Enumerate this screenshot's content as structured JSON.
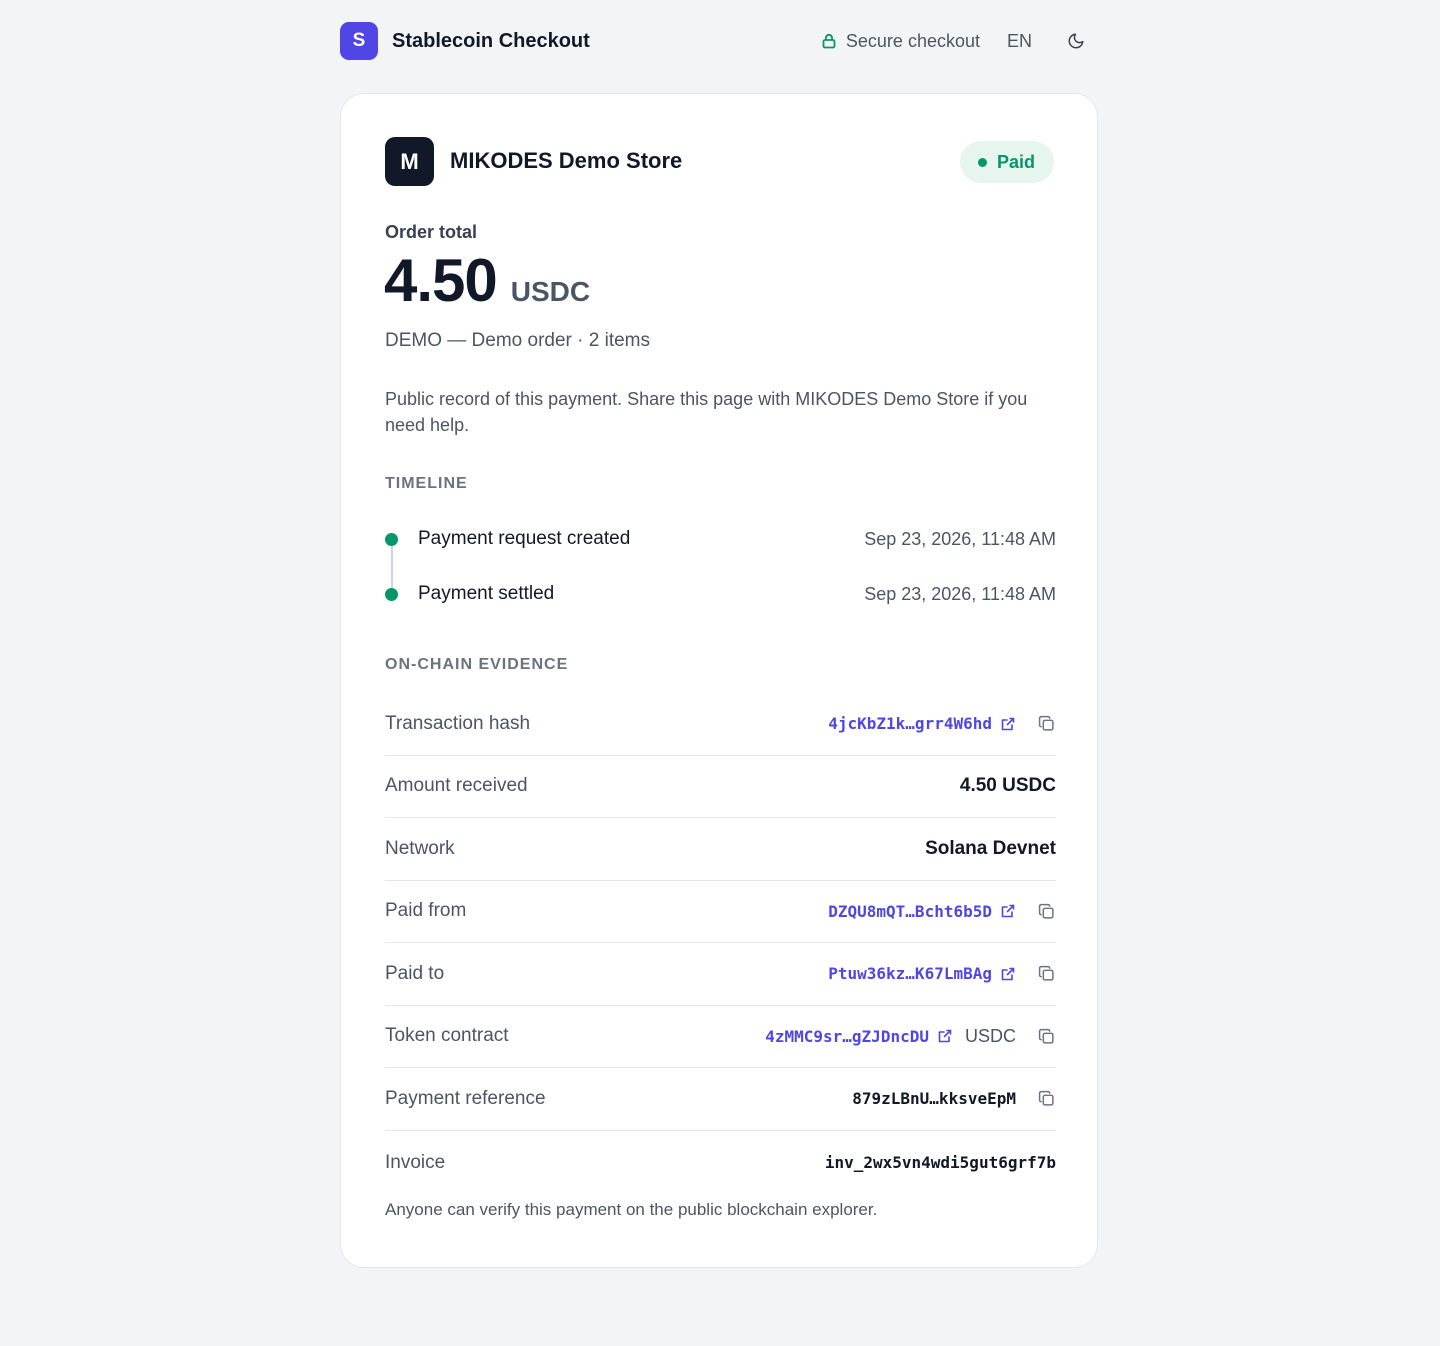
{
  "header": {
    "logo_letter": "S",
    "app_name": "Stablecoin Checkout",
    "secure_label": "Secure checkout",
    "language": "EN",
    "theme_icon": "moon-icon",
    "lock_icon": "lock-icon"
  },
  "merchant": {
    "logo_letter": "M",
    "name": "MIKODES Demo Store"
  },
  "status": {
    "label": "Paid",
    "color": "#059669"
  },
  "order": {
    "total_label": "Order total",
    "amount": "4.50",
    "currency": "USDC",
    "description": "DEMO — Demo order · 2 items"
  },
  "public_note": "Public record of this payment. Share this page with MIKODES Demo Store if you need help.",
  "timeline": {
    "title": "TIMELINE",
    "events": [
      {
        "label": "Payment request created",
        "time": "Sep 23, 2026, 11:48 AM"
      },
      {
        "label": "Payment settled",
        "time": "Sep 23, 2026, 11:48 AM"
      }
    ]
  },
  "evidence": {
    "title": "ON-CHAIN EVIDENCE",
    "tx_hash": {
      "label": "Transaction hash",
      "value": "4jcKbZ1k…grr4W6hd"
    },
    "amount_received": {
      "label": "Amount received",
      "value": "4.50 USDC"
    },
    "network": {
      "label": "Network",
      "value": "Solana Devnet"
    },
    "paid_from": {
      "label": "Paid from",
      "value": "DZQU8mQT…Bcht6b5D"
    },
    "paid_to": {
      "label": "Paid to",
      "value": "Ptuw36kz…K67LmBAg"
    },
    "token_contract": {
      "label": "Token contract",
      "value": "4zMMC9sr…gZJDncDU",
      "suffix": "USDC"
    },
    "payment_reference": {
      "label": "Payment reference",
      "value": "879zLBnU…kksveEpM"
    },
    "invoice": {
      "label": "Invoice",
      "value": "inv_2wx5vn4wdi5gut6grf7b"
    }
  },
  "verify_note": "Anyone can verify this payment on the public blockchain explorer.",
  "colors": {
    "accent": "#4f46e5",
    "success": "#059669",
    "background": "#f3f4f6"
  }
}
